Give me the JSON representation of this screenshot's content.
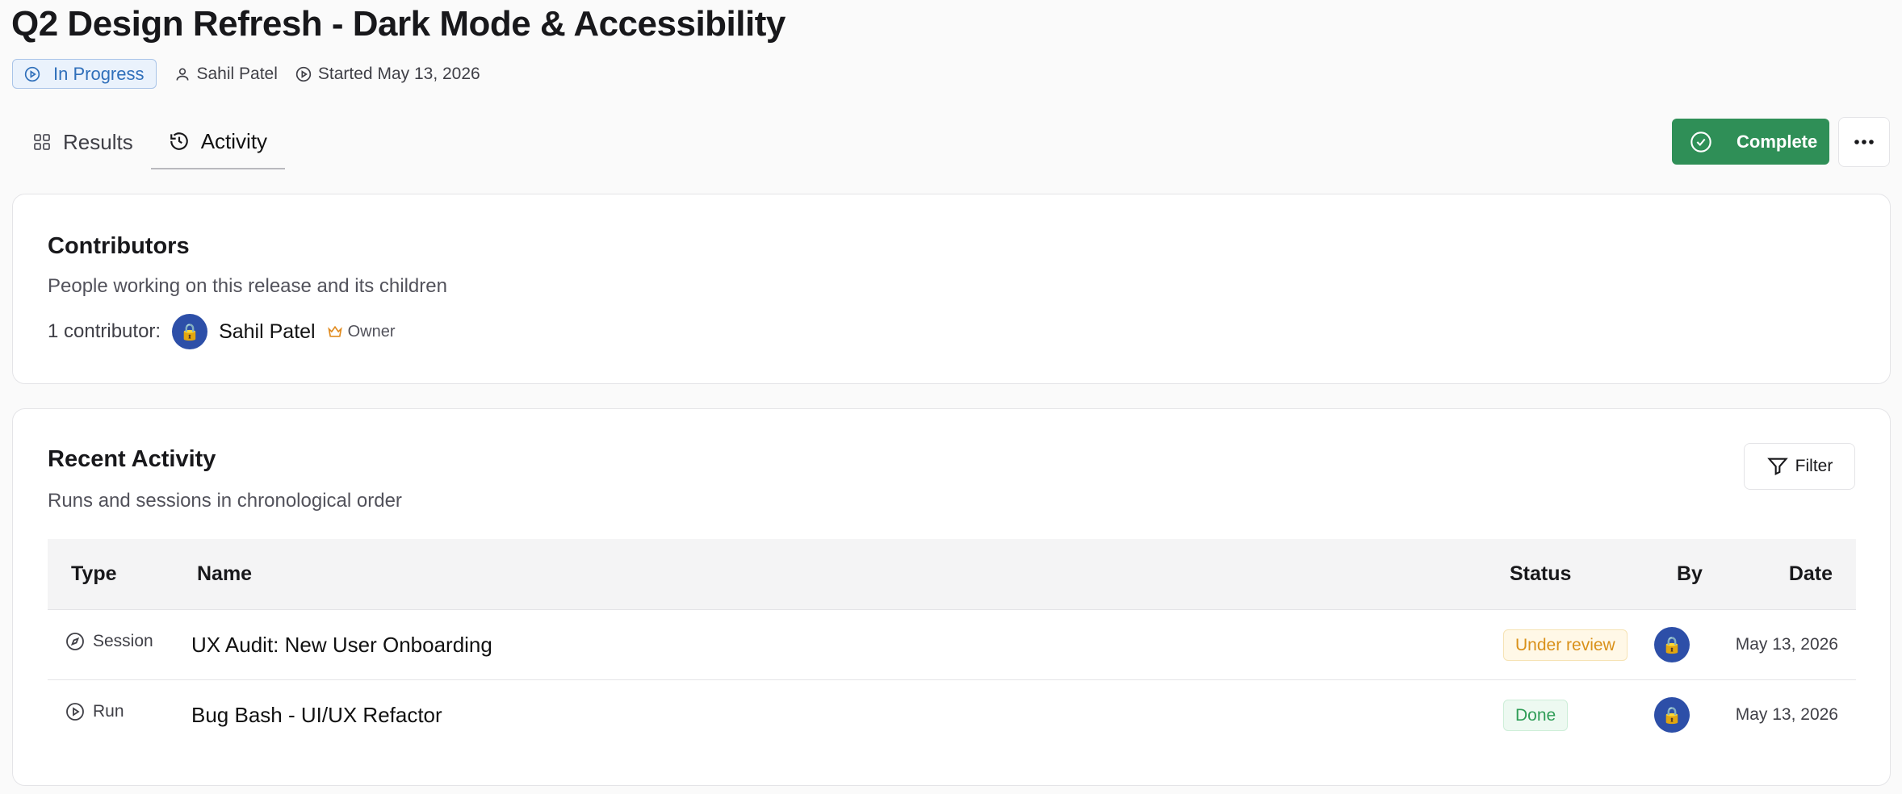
{
  "header": {
    "title": "Q2 Design Refresh - Dark Mode & Accessibility",
    "status": "In Progress",
    "owner": "Sahil Patel",
    "started": "Started May 13, 2026"
  },
  "tabs": [
    {
      "label": "Results",
      "icon": "grid-icon",
      "active": false
    },
    {
      "label": "Activity",
      "icon": "history-icon",
      "active": true
    }
  ],
  "actions": {
    "complete_label": "Complete",
    "accent": "#2f8f57"
  },
  "contributors": {
    "title": "Contributors",
    "subtitle": "People working on this release and its children",
    "count_label": "1 contributor:",
    "people": [
      {
        "name": "Sahil Patel",
        "avatar": "🔒",
        "role": "Owner"
      }
    ]
  },
  "activity": {
    "title": "Recent Activity",
    "subtitle": "Runs and sessions in chronological order",
    "filter_label": "Filter",
    "columns": [
      "Type",
      "Name",
      "Status",
      "By",
      "Date"
    ],
    "rows": [
      {
        "type": "Session",
        "type_icon": "compass-icon",
        "name": "UX Audit: New User Onboarding",
        "status": "Under review",
        "status_color": "#d9911a",
        "by_avatar": "🔒",
        "date": "May 13, 2026"
      },
      {
        "type": "Run",
        "type_icon": "play-circle-icon",
        "name": "Bug Bash - UI/UX Refactor",
        "status": "Done",
        "status_color": "#2f9d57",
        "by_avatar": "🔒",
        "date": "May 13, 2026"
      }
    ]
  }
}
